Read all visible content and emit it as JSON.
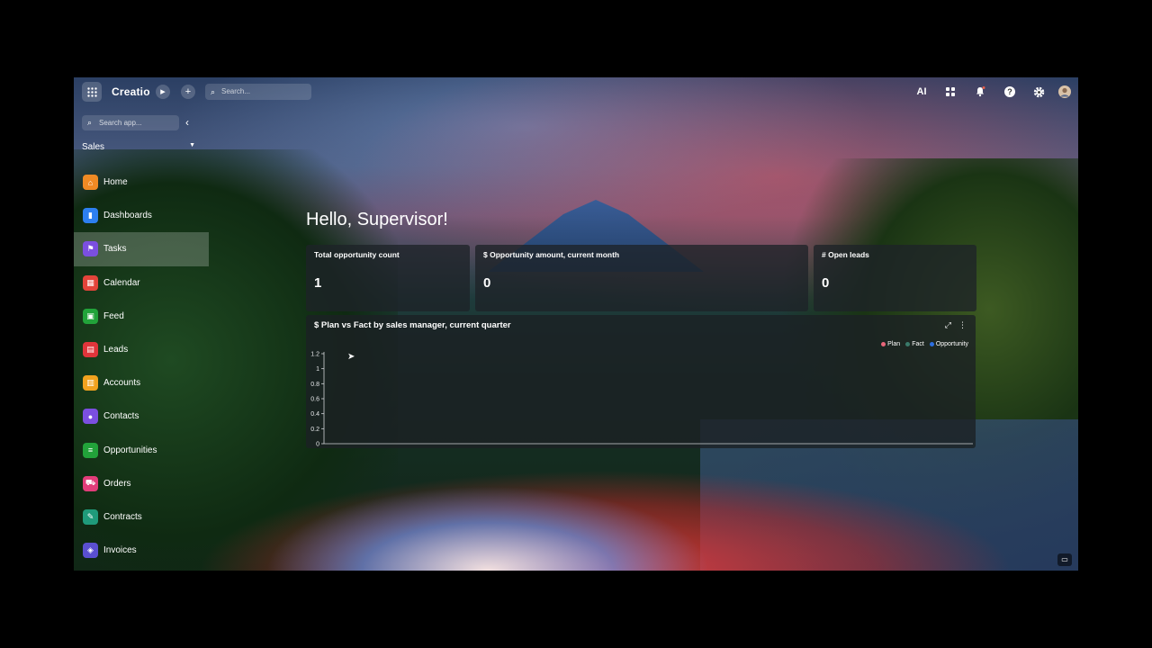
{
  "topbar": {
    "logo": "Creatio",
    "search_placeholder": "Search...",
    "icons": [
      "apps-grid-icon",
      "play-icon",
      "plus-icon",
      "search-icon",
      "ai-icon",
      "apps-icon",
      "bell-icon",
      "help-icon",
      "gear-icon",
      "avatar"
    ],
    "ai_label": "AI"
  },
  "sidebar": {
    "search_placeholder": "Search app...",
    "section": "Sales",
    "items": [
      {
        "label": "Home",
        "icon": "home-icon",
        "color": "#f08a24",
        "glyph": "⌂"
      },
      {
        "label": "Dashboards",
        "icon": "dashboard-icon",
        "color": "#2d7ff0",
        "glyph": "▮"
      },
      {
        "label": "Tasks",
        "icon": "flag-icon",
        "color": "#7b4fe0",
        "glyph": "⚑"
      },
      {
        "label": "Calendar",
        "icon": "calendar-icon",
        "color": "#e3443a",
        "glyph": "▦"
      },
      {
        "label": "Feed",
        "icon": "feed-icon",
        "color": "#22a33a",
        "glyph": "▣"
      },
      {
        "label": "Leads",
        "icon": "leads-icon",
        "color": "#e0353b",
        "glyph": "▤"
      },
      {
        "label": "Accounts",
        "icon": "accounts-icon",
        "color": "#f1a21f",
        "glyph": "▥"
      },
      {
        "label": "Contacts",
        "icon": "contacts-icon",
        "color": "#7b4fe0",
        "glyph": "●"
      },
      {
        "label": "Opportunities",
        "icon": "opportunities-icon",
        "color": "#22a33a",
        "glyph": "≡"
      },
      {
        "label": "Orders",
        "icon": "cart-icon",
        "color": "#e23d7a",
        "glyph": "⛟"
      },
      {
        "label": "Contracts",
        "icon": "contracts-icon",
        "color": "#1f9a7a",
        "glyph": "✎"
      },
      {
        "label": "Invoices",
        "icon": "invoices-icon",
        "color": "#5a4fd0",
        "glyph": "◈"
      }
    ],
    "active_index": 2
  },
  "main": {
    "greeting": "Hello, Supervisor!",
    "cards": [
      {
        "title": "Total opportunity count",
        "value": "1"
      },
      {
        "title": "$ Opportunity amount, current month",
        "value": "0"
      },
      {
        "title": "# Open leads",
        "value": "0"
      }
    ],
    "chart_panel": {
      "title": "$ Plan vs Fact by sales manager, current quarter"
    }
  },
  "chart_data": {
    "type": "bar",
    "title": "$ Plan vs Fact by sales manager, current quarter",
    "categories": [],
    "series": [
      {
        "name": "Plan",
        "values": [],
        "color": "#e8667a"
      },
      {
        "name": "Fact",
        "values": [],
        "color": "#3a7a6a"
      },
      {
        "name": "Opportunity",
        "values": [],
        "color": "#2d6fe0"
      }
    ],
    "ylim": [
      0,
      1.2
    ],
    "yticks": [
      "0",
      "0.2",
      "0.4",
      "0.6",
      "0.8",
      "1",
      "1.2"
    ],
    "legend": "top-right",
    "grid": false
  }
}
